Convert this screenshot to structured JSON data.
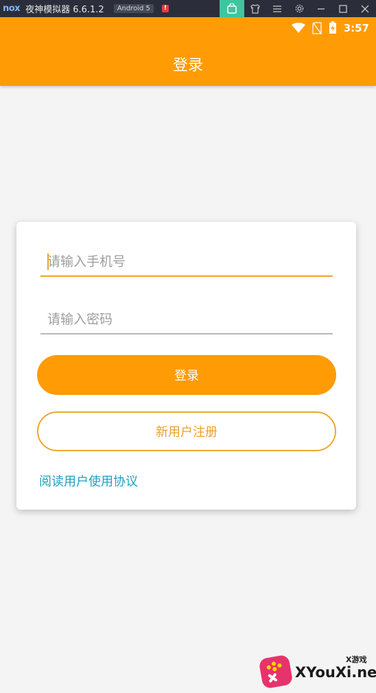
{
  "emulator": {
    "logo": "nox",
    "title": "夜神模拟器 6.6.1.2",
    "android_badge": "Android 5",
    "alert": "!"
  },
  "status_bar": {
    "time": "3:57"
  },
  "app_bar": {
    "title": "登录"
  },
  "form": {
    "phone_placeholder": "请输入手机号",
    "phone_value": "",
    "password_placeholder": "请输入密码",
    "password_value": "",
    "login_button": "登录",
    "register_button": "新用户注册",
    "agreement_link": "阅读用户使用协议"
  },
  "watermark": {
    "text": "XYouXi.net",
    "small": "X游戏"
  },
  "colors": {
    "accent": "#ff9b05",
    "link": "#1fa0c0",
    "card": "#ffffff",
    "background": "#f4f4f4"
  }
}
